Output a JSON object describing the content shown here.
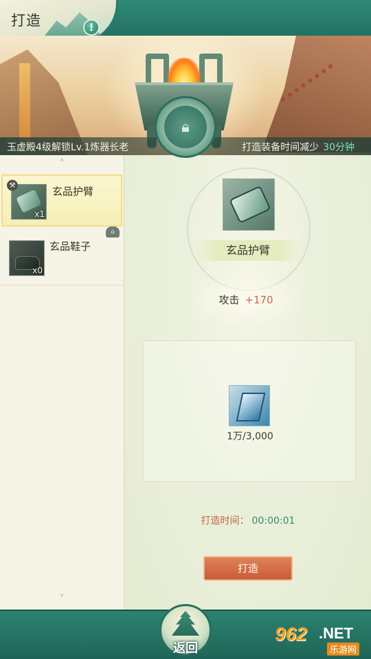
{
  "header": {
    "title": "打造",
    "alert_icon": "!"
  },
  "banner": {
    "unlock_text": "玉虚殿4级解锁Lv.1炼器长老",
    "reduce_label": "打造装备时间减少",
    "reduce_value": "30分钟",
    "lock_icon": "lock-icon"
  },
  "list": {
    "items": [
      {
        "name": "玄品护臂",
        "count": "x1",
        "selected": true
      },
      {
        "name": "玄品鞋子",
        "count": "x0",
        "selected": false
      }
    ]
  },
  "detail": {
    "name": "玄品护臂",
    "stat_label": "攻击",
    "stat_value": "+170",
    "material_count": "1万/3,000",
    "time_label": "打造时间：",
    "time_value": "00:00:01",
    "forge_button": "打造"
  },
  "footer": {
    "back_label": "返回"
  },
  "watermark": {
    "number": "962",
    "suffix": ".NET",
    "site": "乐游网"
  }
}
